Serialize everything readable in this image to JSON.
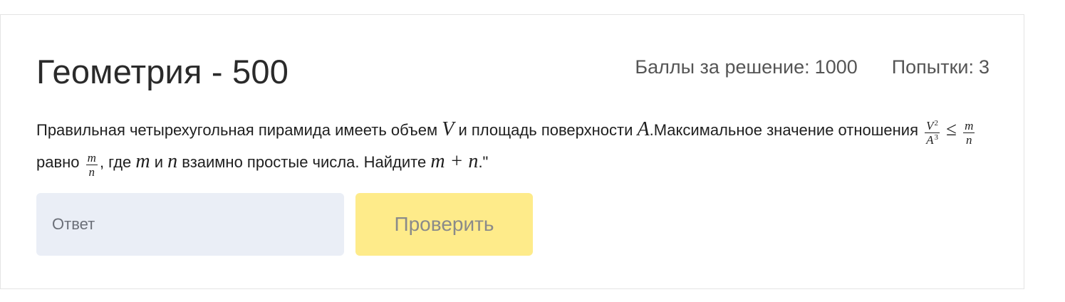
{
  "task": {
    "title": "Геометрия - 500",
    "points_label": "Баллы за решение:",
    "points_value": "1000",
    "attempts_label": "Попытки:",
    "attempts_value": "3"
  },
  "problem": {
    "part1": "Правильная четырехугольная пирамида имееть объем ",
    "var_V": "V",
    "part2": " и площадь поверхности ",
    "var_A": "A",
    "part3": ".Максимальное значение отношения ",
    "frac1_num_base": "V",
    "frac1_num_exp": "2",
    "frac1_den_base": "A",
    "frac1_den_exp": "3",
    "leq": "≤",
    "frac2_num": "m",
    "frac2_den": "n",
    "part4": " равно ",
    "frac3_num": "m",
    "frac3_den": "n",
    "part5": ", где ",
    "var_m": "m",
    "part6": " и ",
    "var_n": "n",
    "part7": " взаимно простые числа. Найдите ",
    "expr": "m + n",
    "part8": ".\""
  },
  "answer_form": {
    "input_placeholder": "Ответ",
    "input_value": "",
    "submit_label": "Проверить"
  },
  "colors": {
    "input_bg": "#eaeef6",
    "button_bg": "#feeb8a",
    "button_text": "#8a8a8a"
  }
}
